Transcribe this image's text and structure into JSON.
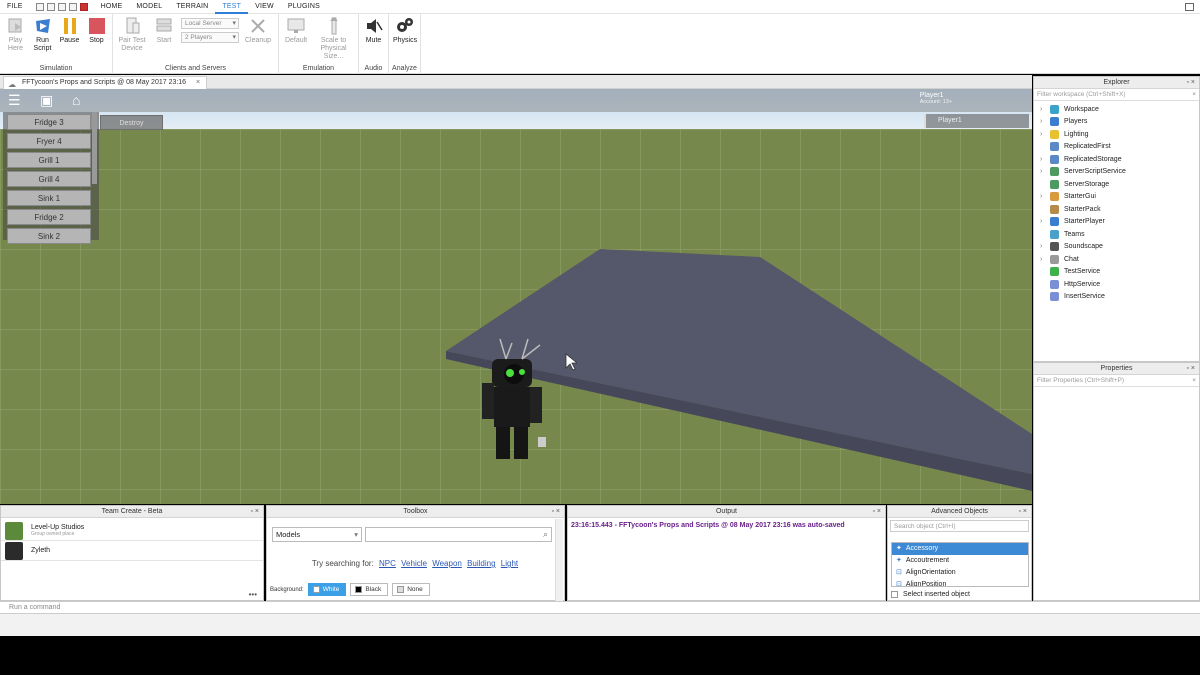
{
  "menubar": {
    "items": [
      "FILE",
      "HOME",
      "MODEL",
      "TERRAIN",
      "TEST",
      "VIEW",
      "PLUGINS"
    ],
    "active": "TEST"
  },
  "ribbon": {
    "simulation": {
      "label": "Simulation",
      "play_line1": "Play",
      "play_line2": "Here",
      "run_line1": "Run",
      "run_line2": "Script",
      "pause": "Pause",
      "stop": "Stop"
    },
    "clients": {
      "label": "Clients and Servers",
      "pair_line1": "Pair Test",
      "pair_line2": "Device",
      "start": "Start",
      "server_select": "Local Server",
      "players_select": "2 Players",
      "cleanup": "Cleanup"
    },
    "emulation": {
      "label": "Emulation",
      "default": "Default",
      "scale_line1": "Scale to",
      "scale_line2": "Physical Size..."
    },
    "audio": {
      "label": "Audio",
      "mute": "Mute"
    },
    "analyze": {
      "label": "Analyze",
      "physics": "Physics"
    }
  },
  "doc_tab": {
    "title": "FFTycoon's Props and Scripts @ 08 May 2017 23:16",
    "close": "×"
  },
  "game": {
    "player_name": "Player1",
    "player_sub": "Account: 13+",
    "player_list_entry": "Player1",
    "destroy_label": "Destroy",
    "items": [
      "Fridge 3",
      "Fryer 4",
      "Grill 1",
      "Grill 4",
      "Sink 1",
      "Fridge 2",
      "Sink 2"
    ]
  },
  "explorer": {
    "title": "Explorer",
    "filter_placeholder": "Filter workspace (Ctrl+Shift+X)",
    "items": [
      {
        "label": "Workspace",
        "expandable": true,
        "color": "#3aa3c9"
      },
      {
        "label": "Players",
        "expandable": true,
        "color": "#3b7ed1"
      },
      {
        "label": "Lighting",
        "expandable": true,
        "color": "#e8c12e"
      },
      {
        "label": "ReplicatedFirst",
        "expandable": false,
        "color": "#5b88c7"
      },
      {
        "label": "ReplicatedStorage",
        "expandable": true,
        "color": "#5b88c7"
      },
      {
        "label": "ServerScriptService",
        "expandable": true,
        "color": "#4c9a5f"
      },
      {
        "label": "ServerStorage",
        "expandable": false,
        "color": "#4c9a5f"
      },
      {
        "label": "StarterGui",
        "expandable": true,
        "color": "#d89a3b"
      },
      {
        "label": "StarterPack",
        "expandable": false,
        "color": "#b58b4a"
      },
      {
        "label": "StarterPlayer",
        "expandable": true,
        "color": "#3b7ed1"
      },
      {
        "label": "Teams",
        "expandable": false,
        "color": "#4aa0c9"
      },
      {
        "label": "Soundscape",
        "expandable": true,
        "color": "#555555"
      },
      {
        "label": "Chat",
        "expandable": true,
        "color": "#9a9a9a"
      },
      {
        "label": "TestService",
        "expandable": false,
        "color": "#3fb14a"
      },
      {
        "label": "HttpService",
        "expandable": false,
        "color": "#7a8fd6"
      },
      {
        "label": "InsertService",
        "expandable": false,
        "color": "#7a8fd6"
      }
    ]
  },
  "properties": {
    "title": "Properties",
    "filter_placeholder": "Filter Properties (Ctrl+Shift+P)"
  },
  "team_create": {
    "title": "Team Create - Beta",
    "users": [
      {
        "name": "Level-Up Studios",
        "sub": "Group owned place",
        "avatar_color": "#5a8a3a"
      },
      {
        "name": "Zyleth",
        "sub": "",
        "avatar_color": "#2b2b2b"
      }
    ]
  },
  "toolbox": {
    "title": "Toolbox",
    "category": "Models",
    "try_prefix": "Try searching for:",
    "suggestions": [
      "NPC",
      "Vehicle",
      "Weapon",
      "Building",
      "Light"
    ],
    "background_label": "Background:",
    "bg_options": [
      {
        "label": "White",
        "color": "#ffffff",
        "selected": true
      },
      {
        "label": "Black",
        "color": "#000000",
        "selected": false
      },
      {
        "label": "None",
        "color": "#dddddd",
        "selected": false
      }
    ]
  },
  "output": {
    "title": "Output",
    "line": "23:16:15.443 - FFTycoon's Props and Scripts @ 08 May 2017 23:16 was auto-saved"
  },
  "advanced_objects": {
    "title": "Advanced Objects",
    "search_placeholder": "Search object (Ctrl+I)",
    "items": [
      "Accessory",
      "Accoutrement",
      "AlignOrientation",
      "AlignPosition"
    ],
    "selected": "Accessory",
    "checkbox_label": "Select inserted object"
  },
  "command_bar": {
    "placeholder": "Run a command"
  }
}
